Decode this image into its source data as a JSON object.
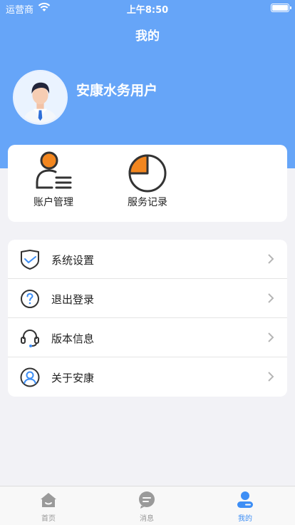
{
  "status_bar": {
    "carrier": "运营商",
    "time": "上午8:50"
  },
  "header": {
    "title": "我的"
  },
  "profile": {
    "username": "安康水务用户"
  },
  "quick_actions": [
    {
      "label": "账户管理",
      "icon": "user-list-icon"
    },
    {
      "label": "服务记录",
      "icon": "pie-chart-icon"
    }
  ],
  "menu": [
    {
      "label": "系统设置",
      "icon": "shield-check-icon"
    },
    {
      "label": "退出登录",
      "icon": "question-circle-icon"
    },
    {
      "label": "版本信息",
      "icon": "headset-icon"
    },
    {
      "label": "关于安康",
      "icon": "user-circle-icon"
    }
  ],
  "tabs": [
    {
      "label": "首页",
      "icon": "home-icon",
      "active": false
    },
    {
      "label": "消息",
      "icon": "message-icon",
      "active": false
    },
    {
      "label": "我的",
      "icon": "profile-icon",
      "active": true
    }
  ],
  "colors": {
    "accent": "#66a5f8",
    "orange": "#f2861f",
    "active_tab": "#3d8ef5"
  }
}
